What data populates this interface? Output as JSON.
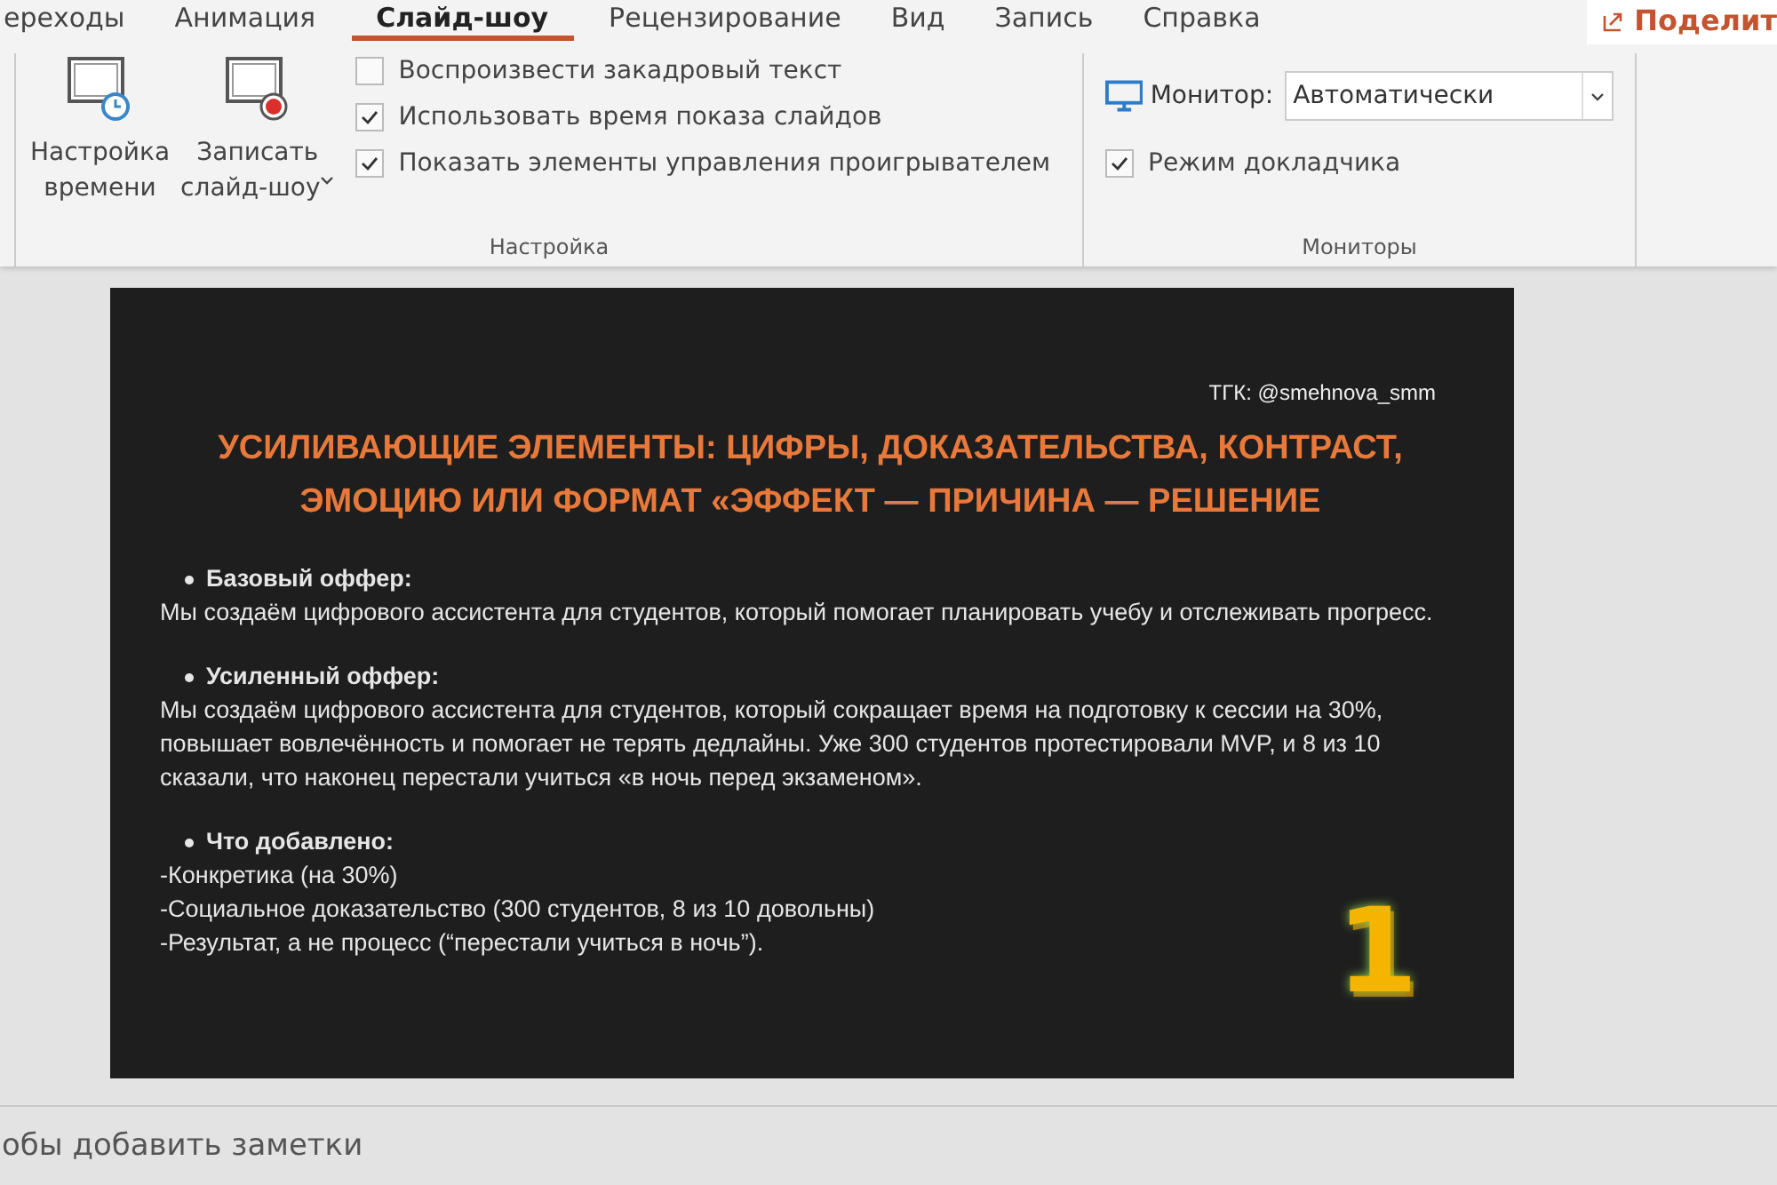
{
  "tabs": [
    {
      "label": "ереходы",
      "selected": false
    },
    {
      "label": "Анимация",
      "selected": false
    },
    {
      "label": "Слайд-шоу",
      "selected": true
    },
    {
      "label": "Рецензирование",
      "selected": false
    },
    {
      "label": "Вид",
      "selected": false
    },
    {
      "label": "Запись",
      "selected": false
    },
    {
      "label": "Справка",
      "selected": false
    }
  ],
  "share_button": "Поделит",
  "groups": [
    {
      "label": "Настройка",
      "big_buttons": [
        {
          "kind": "timer",
          "lines": [
            "Настройка",
            "времени"
          ],
          "dropdown": false
        },
        {
          "kind": "record",
          "lines": [
            "Записать",
            "слайд-шоу"
          ],
          "dropdown": true
        }
      ],
      "checkboxes": [
        {
          "label": "Воспроизвести закадровый текст",
          "checked": false
        },
        {
          "label": "Использовать время показа слайдов",
          "checked": true
        },
        {
          "label": "Показать элементы управления проигрывателем",
          "checked": true
        }
      ]
    },
    {
      "label": "Мониторы",
      "monitor_label": "Монитор:",
      "monitor_value": "Автоматически",
      "checkboxes": [
        {
          "label": "Режим докладчика",
          "checked": true
        }
      ]
    }
  ],
  "slide": {
    "handle": "ТГК: @smehnova_smm",
    "title": "УСИЛИВАЮЩИЕ ЭЛЕМЕНТЫ: ЦИФРЫ, ДОКАЗАТЕЛЬСТВА, КОНТРАСТ, ЭМОЦИЮ ИЛИ ФОРМАТ «ЭФФЕКТ — ПРИЧИНА — РЕШЕНИЕ",
    "sections": [
      {
        "heading": "Базовый оффер:",
        "lines": [
          "Мы создаём цифрового ассистента для студентов, который помогает планировать учебу и отслеживать прогресс."
        ]
      },
      {
        "heading": "Усиленный оффер:",
        "lines": [
          "Мы создаём цифрового ассистента для студентов, который сокращает время на подготовку к сессии на 30%, повышает вовлечённость и помогает не терять дедлайны. Уже 300 студентов протестировали MVP, и 8 из 10 сказали, что наконец перестали учиться «в ночь перед экзаменом»."
        ]
      },
      {
        "heading": "Что добавлено:",
        "lines": [
          "-Конкретика (на 30%)",
          "-Социальное доказательство (300 студентов, 8 из 10 довольны)",
          "-Результат, а не процесс (“перестали учиться в ночь”)."
        ]
      }
    ],
    "badge": "1"
  },
  "notes_placeholder": "обы добавить заметки"
}
